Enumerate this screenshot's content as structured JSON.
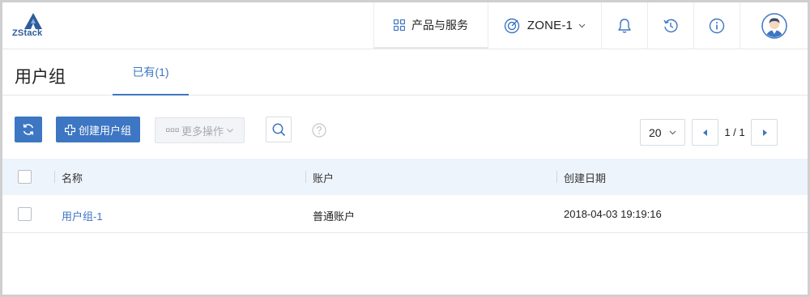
{
  "app": {
    "logo_text": "ZStack"
  },
  "topbar": {
    "products_label": "产品与服务",
    "zone_label": "ZONE-1"
  },
  "page": {
    "title": "用户组",
    "tab_existing": "已有(1)"
  },
  "toolbar": {
    "create_label": "创建用户组",
    "more_actions_label": "更多操作"
  },
  "pagination": {
    "page_size": "20",
    "page_info": "1 / 1"
  },
  "table": {
    "columns": [
      "名称",
      "账户",
      "创建日期"
    ],
    "rows": [
      {
        "name": "用户组-1",
        "account": "普通账户",
        "created": "2018-04-03 19:19:16"
      }
    ]
  },
  "colors": {
    "accent": "#3d76c2",
    "logo": "#2d5c9a",
    "header_bg": "#eef4fb"
  }
}
